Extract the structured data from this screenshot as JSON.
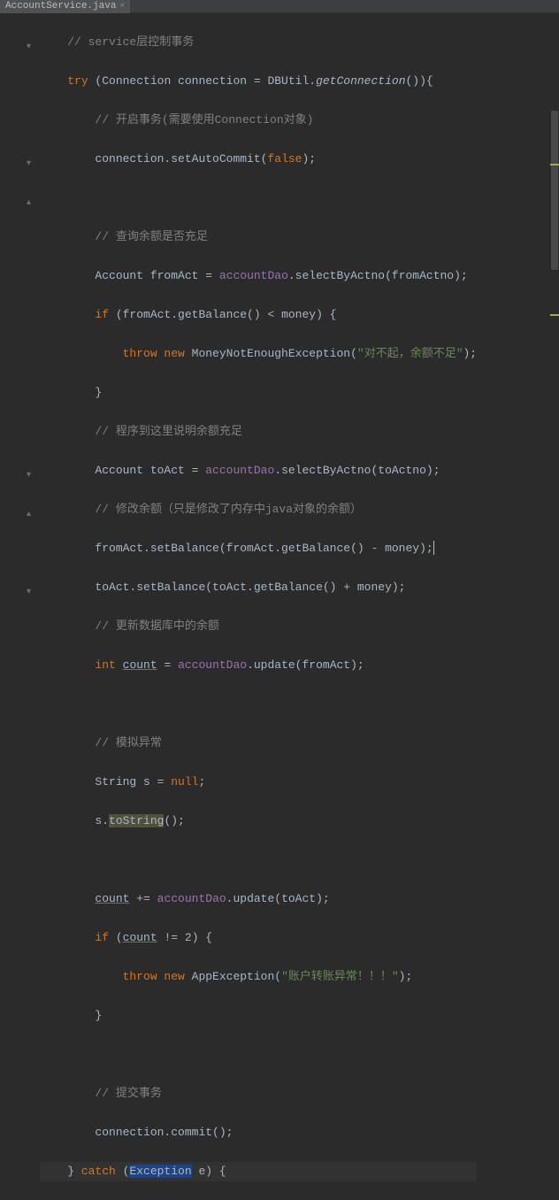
{
  "tab": {
    "filename": "AccountService.java"
  },
  "code": {
    "l1": {
      "a": "// service",
      "b": "层控制事务"
    },
    "l2": {
      "a": "try",
      "b": " (Connection connection = DBUtil.",
      "c": "getConnection",
      "d": "()){"
    },
    "l3": "// 开启事务(需要使用Connection对象)",
    "l4": {
      "a": "connection.setAutoCommit(",
      "b": "false",
      "c": ");"
    },
    "l6": "// 查询余额是否充足",
    "l7": {
      "a": "Account fromAct = ",
      "b": "accountDao",
      "c": ".selectByActno(fromActno);"
    },
    "l8": {
      "a": "if",
      "b": " (fromAct.getBalance() < money) {"
    },
    "l9": {
      "a": "throw new",
      "b": " MoneyNotEnoughException(",
      "c": "\"对不起，余额不足\"",
      "d": ");"
    },
    "l10": "}",
    "l11": "// 程序到这里说明余额充足",
    "l12": {
      "a": "Account toAct = ",
      "b": "accountDao",
      "c": ".selectByActno(toActno);"
    },
    "l13": "// 修改余额（只是修改了内存中java对象的余额）",
    "l14": "fromAct.setBalance(fromAct.getBalance() - money);",
    "l15": "toAct.setBalance(toAct.getBalance() + money);",
    "l16": "// 更新数据库中的余额",
    "l17": {
      "a": "int ",
      "b": "count",
      "c": " = ",
      "d": "accountDao",
      "e": ".update(fromAct);"
    },
    "l19": "// 模拟异常",
    "l20": {
      "a": "String s = ",
      "b": "null",
      "c": ";"
    },
    "l21": {
      "a": "s.",
      "b": "toString",
      "c": "();"
    },
    "l23": {
      "a": "count",
      "b": " += ",
      "c": "accountDao",
      "d": ".update(toAct);"
    },
    "l24": {
      "a": "if",
      "b": " (",
      "c": "count",
      "d": " != ",
      "e": "2",
      "f": ") {"
    },
    "l25": {
      "a": "throw new",
      "b": " AppException(",
      "c": "\"账户转账异常！！！\"",
      "d": ");"
    },
    "l26": "}",
    "l28": "// 提交事务",
    "l29": "connection.commit();",
    "l30": {
      "a": "} ",
      "b": "catch",
      "c": " (",
      "d": "Exception",
      "e": " e) {"
    }
  }
}
